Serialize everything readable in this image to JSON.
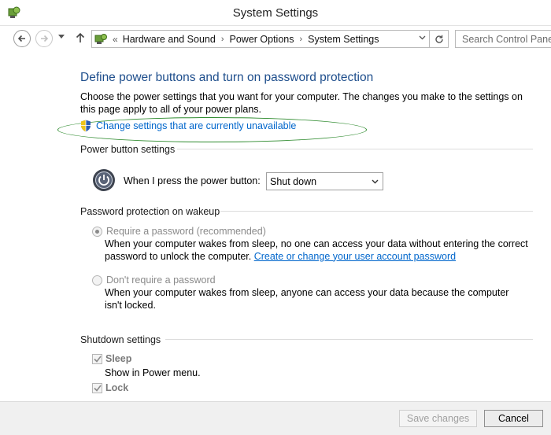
{
  "window": {
    "title": "System Settings"
  },
  "nav": {
    "breadcrumb_sep": "«",
    "breadcrumbs": [
      "Hardware and Sound",
      "Power Options",
      "System Settings"
    ],
    "search_placeholder": "Search Control Panel"
  },
  "main": {
    "heading": "Define power buttons and turn on password protection",
    "description": "Choose the power settings that you want for your computer. The changes you make to the settings on this page apply to all of your power plans.",
    "change_settings_link": "Change settings that are currently unavailable",
    "power_section": {
      "title": "Power button settings",
      "label": "When I press the power button:",
      "selected": "Shut down"
    },
    "password_section": {
      "title": "Password protection on wakeup",
      "require": {
        "label": "Require a password (recommended)",
        "checked": true,
        "text": "When your computer wakes from sleep, no one can access your data without entering the correct password to unlock the computer.",
        "link": "Create or change your user account password"
      },
      "dont_require": {
        "label": "Don't require a password",
        "checked": false,
        "text": "When your computer wakes from sleep, anyone can access your data because the computer isn't locked."
      }
    },
    "shutdown_section": {
      "title": "Shutdown settings",
      "sleep": {
        "label": "Sleep",
        "sub": "Show in Power menu.",
        "checked": true
      },
      "lock": {
        "label": "Lock",
        "checked": true
      }
    }
  },
  "footer": {
    "save_label": "Save changes",
    "cancel_label": "Cancel"
  },
  "colors": {
    "heading": "#1e4e8c",
    "link": "#0066cc",
    "highlight": "#2e8b2e"
  }
}
